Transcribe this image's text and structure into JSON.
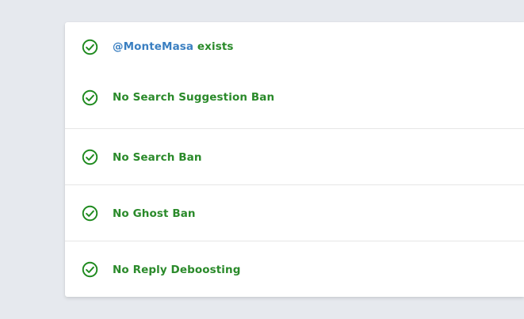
{
  "colors": {
    "background": "#e6e9ee",
    "card": "#ffffff",
    "success_green": "#2a8a2a",
    "link_blue": "#3a7fc1",
    "divider": "#e6e6e6"
  },
  "results": {
    "account": {
      "handle": "@MonteMasa",
      "suffix": " exists",
      "icon": "check-circle-icon"
    },
    "items": [
      {
        "label": "No Search Suggestion Ban",
        "icon": "check-circle-icon"
      },
      {
        "label": "No Search Ban",
        "icon": "check-circle-icon"
      },
      {
        "label": "No Ghost Ban",
        "icon": "check-circle-icon"
      },
      {
        "label": "No Reply Deboosting",
        "icon": "check-circle-icon"
      }
    ]
  }
}
